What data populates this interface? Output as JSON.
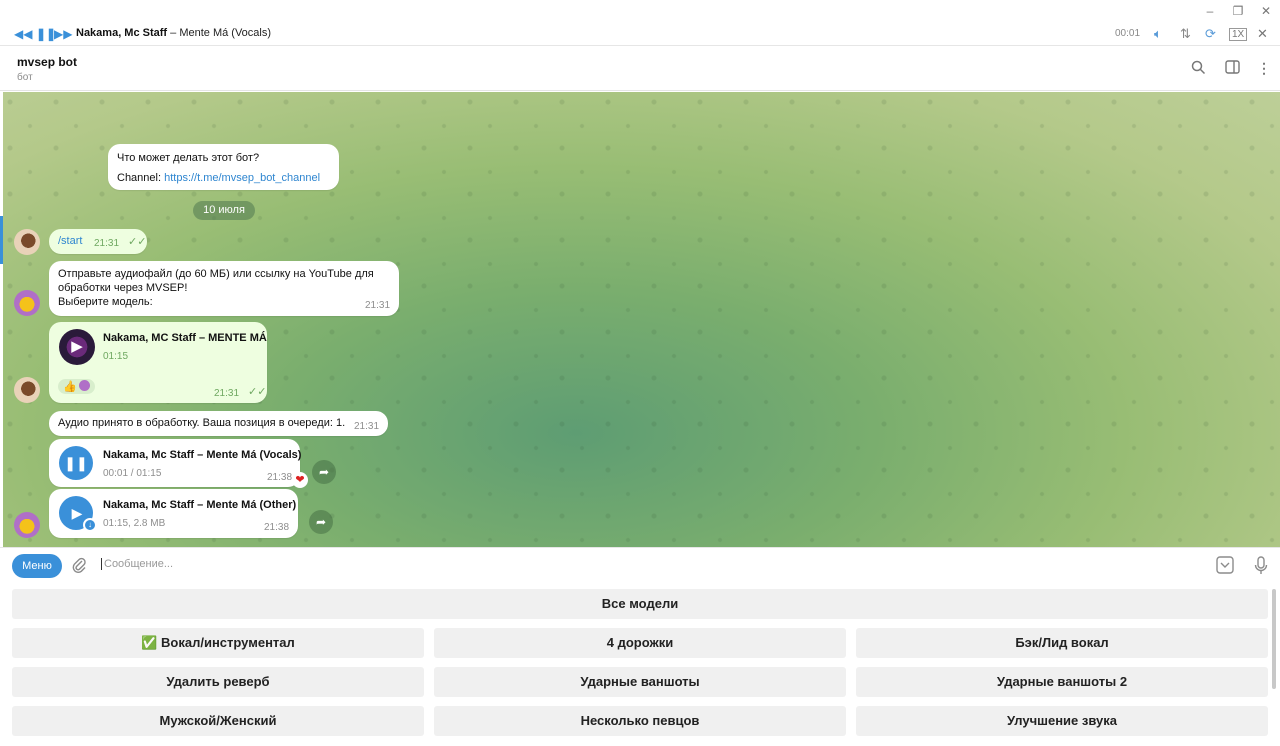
{
  "window": {
    "restore_icon": "restore-icon",
    "minimize_icon": "minimize-icon",
    "close_icon": "close-icon"
  },
  "player": {
    "title_bold": "Nakama, Mc Staff",
    "title_rest": " – Mente Má (Vocals)",
    "time": "00:01",
    "speed": "1X"
  },
  "header": {
    "name": "mvsep bot",
    "status": "бот"
  },
  "chat": {
    "intro": {
      "question": "Что может делать этот бот?",
      "channel_label": "Channel: ",
      "channel_link": "https://t.me/mvsep_bot_channel"
    },
    "date": "10 июля",
    "msg_start": {
      "text": "/start",
      "time": "21:31"
    },
    "msg_bot1": {
      "line1": "Отправьте аудиофайл (до 60 МБ) или ссылку на YouTube для",
      "line2": "обработки через MVSEP!",
      "line3": "Выберите модель:",
      "time": "21:31"
    },
    "msg_audio_out": {
      "title": "Nakama, MC Staff – MENTE MÁ",
      "duration": "01:15",
      "time": "21:31",
      "reactions": "👍"
    },
    "msg_accepted": {
      "text": "Аудио принято в обработку. Ваша позиция в очереди: 1.",
      "time": "21:31"
    },
    "msg_vocals": {
      "title": "Nakama, Mc Staff – Mente Má (Vocals)",
      "progress": "00:01 / 01:15",
      "time": "21:38",
      "reaction": "❤"
    },
    "msg_other": {
      "title": "Nakama, Mc Staff – Mente Má (Other)",
      "info": "01:15, 2.8 MB",
      "time": "21:38"
    }
  },
  "composer": {
    "menu": "Меню",
    "placeholder": "Сообщение..."
  },
  "keyboard": {
    "row1": [
      "Все модели"
    ],
    "row2": [
      "✅ Вокал/инструментал",
      "4 дорожки",
      "Бэк/Лид вокал"
    ],
    "row3": [
      "Удалить реверб",
      "Ударные ваншоты",
      "Ударные ваншоты 2"
    ],
    "row4": [
      "Мужской/Женский",
      "Несколько певцов",
      "Улучшение звука"
    ]
  }
}
